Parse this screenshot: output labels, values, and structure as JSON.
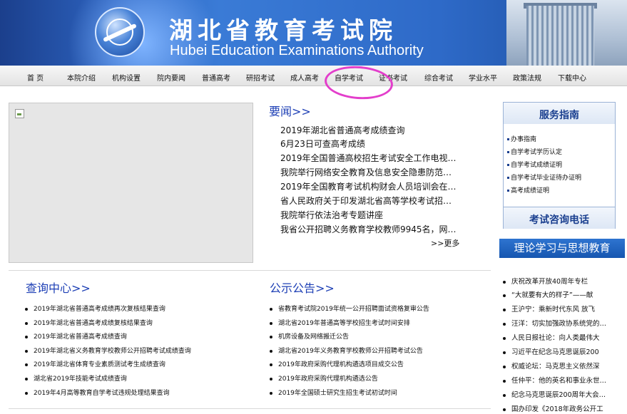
{
  "header": {
    "title_cn": "湖北省教育考试院",
    "title_en": "Hubei Education Examinations Authority"
  },
  "nav": {
    "items": [
      "首  页",
      "本院介绍",
      "机构设置",
      "院内要闻",
      "普通高考",
      "研招考试",
      "成人高考",
      "自学考试",
      "证书考试",
      "综合考试",
      "学业水平",
      "政策法规",
      "下载中心"
    ],
    "highlighted": "自学考试",
    "highlight_color": "#e33ecb"
  },
  "news": {
    "title": "要闻>>",
    "items": [
      "2019年湖北省普通高考成绩查询",
      "6月23日可查高考成绩",
      "2019年全国普通高校招生考试安全工作电视…",
      "我院举行网络安全教育及信息安全隐患防范…",
      "2019年全国教育考试机构财会人员培训会在…",
      "省人民政府关于印发湖北省高等学校考试招…",
      "我院举行依法治考专题讲座",
      "我省公开招聘义务教育学校教师9945名，网…"
    ],
    "more": ">>更多"
  },
  "service": {
    "title": "服务指南",
    "items": [
      "办事指南",
      "自学考试学历认定",
      "自学考试成绩证明",
      "自学考试毕业证待办证明",
      "高考成绩证明"
    ],
    "hotline_title": "考试咨询电话"
  },
  "theory": {
    "title": "理论学习与思想教育",
    "items": [
      "庆祝改革开放40周年专栏",
      "“大就要有大的样子”——献",
      "王沪宁：乘新时代东风 放飞",
      "汪洋：切实加强政协系统党的…",
      "人民日报社论：向人类最伟大",
      "习近平在纪念马克思诞辰200",
      "权威论坛：马克思主义依然深",
      "任仲平：他的英名和事业永世…",
      "纪念马克思诞辰200周年大会…",
      "国办印发《2018年政务公开工"
    ]
  },
  "query": {
    "title": "查询中心>>",
    "items": [
      "2019年湖北省普通高考成绩再次复核结果查询",
      "2019年湖北省普通高考成绩复核结果查询",
      "2019年湖北省普通高考成绩查询",
      "2019年湖北省义务教育学校教师公开招聘考试成绩查询",
      "2019年湖北省体育专业素质测试考生成绩查询",
      "湖北省2019年技能考试成绩查询",
      "2019年4月高等教育自学考试违规处理结果查询"
    ]
  },
  "notice": {
    "title": "公示公告>>",
    "items": [
      "省教育考试院2019年统一公开招聘面试资格复审公告",
      "湖北省2019年普通高等学校招生考试时间安排",
      "机房设备及网络搬迁公告",
      "湖北省2019年义务教育学校教师公开招聘考试公告",
      "2019年政府采购代理机构遴选项目成交公告",
      "2019年政府采购代理机构遴选公告",
      "2019年全国硕士研究生招生考试初试时间"
    ]
  }
}
